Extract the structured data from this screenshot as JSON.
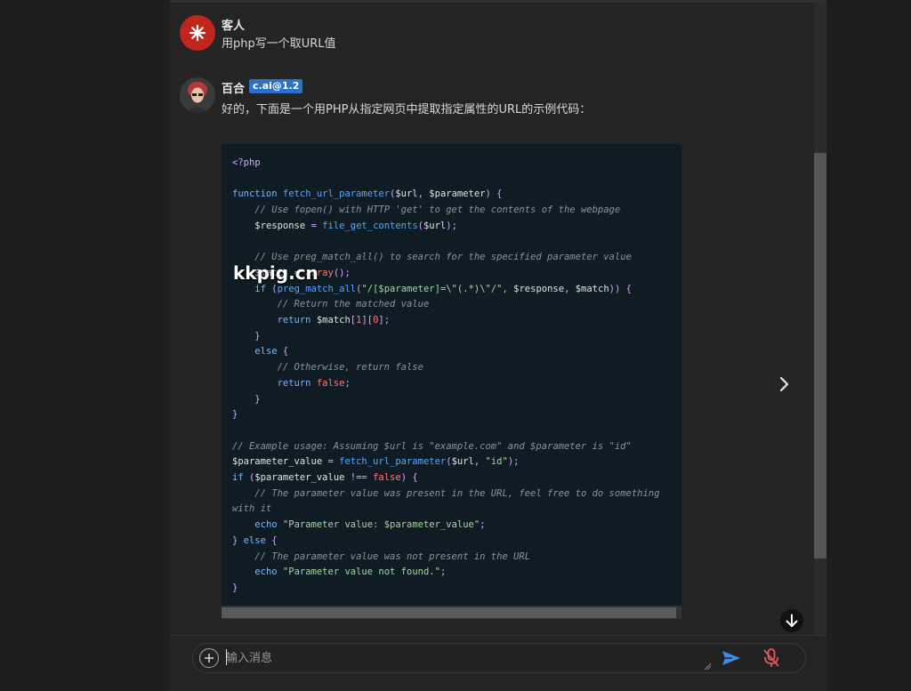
{
  "conversation": {
    "guest": {
      "name": "客人",
      "message": "用php写一个取URL值"
    },
    "bot": {
      "name": "百合",
      "badge": "c.ai@1.2",
      "intro": "好的，下面是一个用PHP从指定网页中提取指定属性的URL的示例代码：",
      "code_lines": [
        "<?php",
        "",
        "function fetch_url_parameter($url, $parameter) {",
        "    // Use fopen() with HTTP 'get' to get the contents of the webpage",
        "    $response = file_get_contents($url);",
        "",
        "    // Use preg_match_all() to search for the specified parameter value",
        "    $match = array();",
        "    if (preg_match_all(\"/[$parameter]=\\\"(.*)\\\"/\", $response, $match)) {",
        "        // Return the matched value",
        "        return $match[1][0];",
        "    }",
        "    else {",
        "        // Otherwise, return false",
        "        return false;",
        "    }",
        "}",
        "",
        "// Example usage: Assuming $url is \"example.com\" and $parameter is \"id\"",
        "$parameter_value = fetch_url_parameter($url, \"id\");",
        "if ($parameter_value !== false) {",
        "    // The parameter value was present in the URL, feel free to do something",
        "with it",
        "    echo \"Parameter value: $parameter_value\";",
        "} else {",
        "    // The parameter value was not present in the URL",
        "    echo \"Parameter value not found.\";",
        "}"
      ]
    }
  },
  "watermark": "kkpig.cn",
  "composer": {
    "placeholder": "输入消息"
  },
  "icons": {
    "guest_avatar": "sparkle-icon",
    "next": "chevron-right-icon",
    "scroll_down": "arrow-down-icon",
    "add": "plus-circle-icon",
    "send": "send-icon",
    "mic": "mic-off-icon"
  },
  "colors": {
    "guest_avatar": "#c0261b",
    "badge": "#2f6fc4",
    "code_bg": "#0f1c24",
    "send": "#3b8ee8",
    "mic_off": "#e05a5a"
  }
}
